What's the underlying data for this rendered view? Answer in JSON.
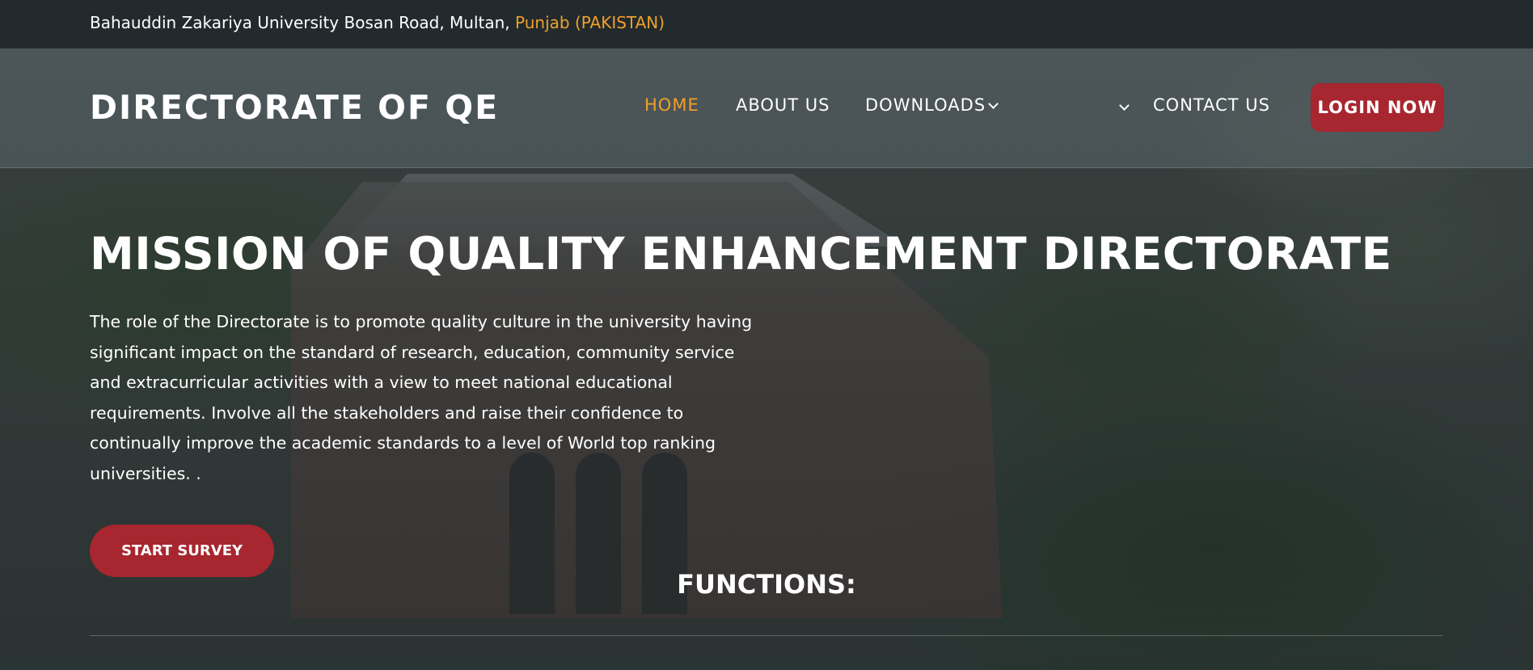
{
  "topbar": {
    "address": "Bahauddin Zakariya University Bosan Road, Multan,",
    "region": "Punjab (PAKISTAN)"
  },
  "header": {
    "logo": "DIRECTORATE OF QE",
    "nav": {
      "home": "HOME",
      "about": "ABOUT US",
      "downloads": "DOWNLOADS",
      "contact": "CONTACT US"
    },
    "login_label": "LOGIN NOW"
  },
  "hero": {
    "title": "MISSION OF QUALITY ENHANCEMENT DIRECTORATE",
    "description": "The role of the Directorate is to promote quality culture in the university having significant impact on the standard of research, education, community service and extracurricular activities with a view to meet national educational requirements. Involve all the stakeholders and raise their confidence to continually improve the academic standards to a level of World top ranking universities. .",
    "survey_label": "START SURVEY"
  },
  "functions": {
    "heading": "FUNCTIONS:"
  },
  "colors": {
    "accent": "#f0a02a",
    "button": "#a7262f",
    "topbar_bg": "#222a2e"
  },
  "icons": {
    "downloads_dropdown": "chevron-down-icon",
    "extra_dropdown": "chevron-down-icon"
  }
}
